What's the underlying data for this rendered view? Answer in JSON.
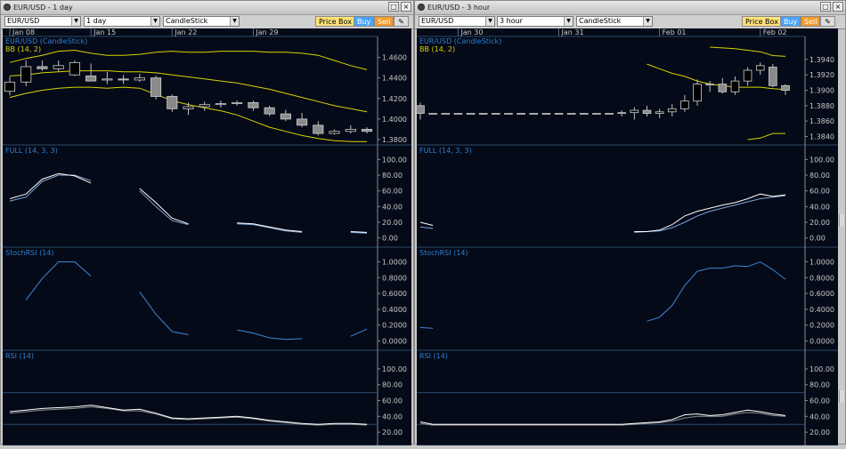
{
  "windows": [
    {
      "id": "left",
      "title": "EUR/USD - 1 day",
      "symbol": "EUR/USD",
      "interval": "1 day",
      "chart_type": "CandleStick",
      "price_box_label": "Price Box",
      "buy_label": "Buy",
      "sell_label": "Sell",
      "date_labels": [
        {
          "label": "Jan 08",
          "i": 0
        },
        {
          "label": "Jan 15",
          "i": 5
        },
        {
          "label": "Jan 22",
          "i": 10
        },
        {
          "label": "Jan 29",
          "i": 15
        }
      ],
      "panels": {
        "price": {
          "legend1": "EUR/USD (CandleStick)",
          "legend2": "BB (14, 2)",
          "ticks": [
            "1.4600",
            "1.4400",
            "1.4200",
            "1.4000",
            "1.3800"
          ],
          "min": 1.38,
          "max": 1.47
        },
        "full": {
          "legend": "FULL (14, 3, 3)",
          "ticks": [
            "100.00",
            "80.00",
            "60.00",
            "40.00",
            "20.00",
            "0.00"
          ],
          "min": -5,
          "max": 105
        },
        "stochrsi": {
          "legend": "StochRSI (14)",
          "ticks": [
            "1.0000",
            "0.8000",
            "0.6000",
            "0.4000",
            "0.2000",
            "0.0000"
          ],
          "min": -0.05,
          "max": 1.05
        },
        "rsi": {
          "legend": "RSI (14)",
          "ticks": [
            "100.00",
            "80.00",
            "60.00",
            "40.00",
            "20.00"
          ],
          "min": 10,
          "max": 110
        }
      },
      "candles": [
        {
          "o": 1.427,
          "h": 1.441,
          "l": 1.423,
          "c": 1.436
        },
        {
          "o": 1.436,
          "h": 1.457,
          "l": 1.432,
          "c": 1.451
        },
        {
          "o": 1.451,
          "h": 1.457,
          "l": 1.447,
          "c": 1.449
        },
        {
          "o": 1.449,
          "h": 1.457,
          "l": 1.446,
          "c": 1.452
        },
        {
          "o": 1.443,
          "h": 1.457,
          "l": 1.442,
          "c": 1.455
        },
        {
          "o": 1.442,
          "h": 1.454,
          "l": 1.439,
          "c": 1.437
        },
        {
          "o": 1.438,
          "h": 1.446,
          "l": 1.434,
          "c": 1.439
        },
        {
          "o": 1.439,
          "h": 1.443,
          "l": 1.434,
          "c": 1.438
        },
        {
          "o": 1.438,
          "h": 1.444,
          "l": 1.436,
          "c": 1.44
        },
        {
          "o": 1.44,
          "h": 1.442,
          "l": 1.419,
          "c": 1.422
        },
        {
          "o": 1.422,
          "h": 1.424,
          "l": 1.407,
          "c": 1.41
        },
        {
          "o": 1.41,
          "h": 1.416,
          "l": 1.404,
          "c": 1.412
        },
        {
          "o": 1.412,
          "h": 1.417,
          "l": 1.408,
          "c": 1.414
        },
        {
          "o": 1.414,
          "h": 1.418,
          "l": 1.411,
          "c": 1.415
        },
        {
          "o": 1.415,
          "h": 1.418,
          "l": 1.413,
          "c": 1.416
        },
        {
          "o": 1.416,
          "h": 1.418,
          "l": 1.408,
          "c": 1.411
        },
        {
          "o": 1.411,
          "h": 1.413,
          "l": 1.403,
          "c": 1.405
        },
        {
          "o": 1.405,
          "h": 1.409,
          "l": 1.398,
          "c": 1.4
        },
        {
          "o": 1.4,
          "h": 1.406,
          "l": 1.392,
          "c": 1.394
        },
        {
          "o": 1.394,
          "h": 1.398,
          "l": 1.384,
          "c": 1.386
        },
        {
          "o": 1.386,
          "h": 1.39,
          "l": 1.385,
          "c": 1.388
        },
        {
          "o": 1.388,
          "h": 1.394,
          "l": 1.386,
          "c": 1.39
        },
        {
          "o": 1.39,
          "h": 1.392,
          "l": 1.386,
          "c": 1.388
        }
      ],
      "bb_upper": [
        1.455,
        1.459,
        1.462,
        1.466,
        1.467,
        1.464,
        1.462,
        1.462,
        1.463,
        1.465,
        1.466,
        1.465,
        1.465,
        1.466,
        1.466,
        1.466,
        1.465,
        1.465,
        1.464,
        1.462,
        1.457,
        1.452,
        1.448
      ],
      "bb_mid": [
        1.442,
        1.443,
        1.445,
        1.446,
        1.447,
        1.447,
        1.447,
        1.446,
        1.446,
        1.445,
        1.443,
        1.441,
        1.439,
        1.437,
        1.435,
        1.432,
        1.429,
        1.425,
        1.421,
        1.417,
        1.413,
        1.41,
        1.407
      ],
      "bb_lower": [
        1.421,
        1.425,
        1.428,
        1.43,
        1.431,
        1.431,
        1.43,
        1.431,
        1.43,
        1.424,
        1.418,
        1.414,
        1.411,
        1.408,
        1.404,
        1.398,
        1.392,
        1.388,
        1.384,
        1.381,
        1.379,
        1.378,
        1.378
      ],
      "full_k": [
        50,
        56,
        75,
        82,
        79,
        70,
        null,
        null,
        63,
        45,
        25,
        18,
        null,
        null,
        19,
        18,
        14,
        10,
        8,
        null,
        null,
        8,
        7
      ],
      "full_d": [
        47,
        52,
        72,
        80,
        80,
        73,
        null,
        null,
        60,
        40,
        22,
        17,
        null,
        null,
        18,
        17,
        13,
        9,
        7,
        null,
        null,
        7,
        6
      ],
      "stochrsi": [
        null,
        0.52,
        0.79,
        1.0,
        1.0,
        0.82,
        null,
        null,
        0.62,
        0.34,
        0.12,
        0.08,
        null,
        null,
        0.14,
        0.1,
        0.04,
        0.02,
        0.03,
        null,
        null,
        0.06,
        0.15
      ],
      "rsi": [
        46,
        48,
        50,
        51,
        52,
        54,
        51,
        48,
        49,
        44,
        38,
        37,
        38,
        39,
        40,
        38,
        35,
        33,
        31,
        30,
        31,
        31,
        30
      ],
      "rsi_sig": [
        44,
        46,
        48,
        49,
        50,
        52,
        50,
        47,
        47,
        43,
        37,
        36,
        37,
        38,
        39,
        37,
        34,
        32,
        30,
        29,
        30,
        30,
        29
      ]
    },
    {
      "id": "right",
      "title": "EUR/USD - 3 hour",
      "symbol": "EUR/USD",
      "interval": "3 hour",
      "chart_type": "CandleStick",
      "price_box_label": "Price Box",
      "buy_label": "Buy",
      "sell_label": "Sell",
      "date_labels": [
        {
          "label": "Jan 30",
          "i": 3
        },
        {
          "label": "Jan 31",
          "i": 11
        },
        {
          "label": "Feb 01",
          "i": 19
        },
        {
          "label": "Feb 02",
          "i": 27
        }
      ],
      "panels": {
        "price": {
          "legend1": "EUR/USD (CandleStick)",
          "legend2": "BB (14, 2)",
          "ticks": [
            "1.3940",
            "1.3920",
            "1.3900",
            "1.3880",
            "1.3860",
            "1.3840"
          ],
          "min": 1.3836,
          "max": 1.3956
        },
        "full": {
          "legend": "FULL (14, 3, 3)",
          "ticks": [
            "100.00",
            "80.00",
            "60.00",
            "40.00",
            "20.00",
            "0.00"
          ],
          "min": -5,
          "max": 105
        },
        "stochrsi": {
          "legend": "StochRSI (14)",
          "ticks": [
            "1.0000",
            "0.8000",
            "0.6000",
            "0.4000",
            "0.2000",
            "0.0000"
          ],
          "min": -0.05,
          "max": 1.05
        },
        "rsi": {
          "legend": "RSI (14)",
          "ticks": [
            "100.00",
            "80.00",
            "60.00",
            "40.00",
            "20.00"
          ],
          "min": 10,
          "max": 110
        }
      },
      "candles": [
        {
          "o": 1.388,
          "h": 1.3884,
          "l": 1.3862,
          "c": 1.387
        },
        {
          "o": 1.387,
          "h": 1.387,
          "l": 1.387,
          "c": 1.387
        },
        {
          "o": 1.387,
          "h": 1.387,
          "l": 1.387,
          "c": 1.387
        },
        {
          "o": 1.387,
          "h": 1.387,
          "l": 1.387,
          "c": 1.387
        },
        {
          "o": 1.387,
          "h": 1.387,
          "l": 1.387,
          "c": 1.387
        },
        {
          "o": 1.387,
          "h": 1.387,
          "l": 1.387,
          "c": 1.387
        },
        {
          "o": 1.387,
          "h": 1.387,
          "l": 1.387,
          "c": 1.387
        },
        {
          "o": 1.387,
          "h": 1.387,
          "l": 1.387,
          "c": 1.387
        },
        {
          "o": 1.387,
          "h": 1.387,
          "l": 1.387,
          "c": 1.387
        },
        {
          "o": 1.387,
          "h": 1.387,
          "l": 1.387,
          "c": 1.387
        },
        {
          "o": 1.387,
          "h": 1.387,
          "l": 1.387,
          "c": 1.387
        },
        {
          "o": 1.387,
          "h": 1.387,
          "l": 1.387,
          "c": 1.387
        },
        {
          "o": 1.387,
          "h": 1.387,
          "l": 1.387,
          "c": 1.387
        },
        {
          "o": 1.387,
          "h": 1.387,
          "l": 1.387,
          "c": 1.387
        },
        {
          "o": 1.387,
          "h": 1.387,
          "l": 1.387,
          "c": 1.387
        },
        {
          "o": 1.387,
          "h": 1.387,
          "l": 1.387,
          "c": 1.387
        },
        {
          "o": 1.387,
          "h": 1.3874,
          "l": 1.3866,
          "c": 1.3871
        },
        {
          "o": 1.3871,
          "h": 1.3878,
          "l": 1.3862,
          "c": 1.3874
        },
        {
          "o": 1.3874,
          "h": 1.388,
          "l": 1.3866,
          "c": 1.387
        },
        {
          "o": 1.387,
          "h": 1.3876,
          "l": 1.3864,
          "c": 1.3872
        },
        {
          "o": 1.3872,
          "h": 1.3882,
          "l": 1.3866,
          "c": 1.3876
        },
        {
          "o": 1.3876,
          "h": 1.3894,
          "l": 1.3872,
          "c": 1.3886
        },
        {
          "o": 1.3886,
          "h": 1.3914,
          "l": 1.388,
          "c": 1.3908
        },
        {
          "o": 1.3908,
          "h": 1.3912,
          "l": 1.3898,
          "c": 1.3908
        },
        {
          "o": 1.3908,
          "h": 1.3916,
          "l": 1.3896,
          "c": 1.3898
        },
        {
          "o": 1.3898,
          "h": 1.3918,
          "l": 1.3894,
          "c": 1.3912
        },
        {
          "o": 1.3912,
          "h": 1.393,
          "l": 1.3906,
          "c": 1.3926
        },
        {
          "o": 1.3926,
          "h": 1.3936,
          "l": 1.392,
          "c": 1.3932
        },
        {
          "o": 1.393,
          "h": 1.3934,
          "l": 1.3904,
          "c": 1.3906
        },
        {
          "o": 1.3906,
          "h": 1.3908,
          "l": 1.3894,
          "c": 1.39
        }
      ],
      "bb_upper": [
        1.386,
        null,
        null,
        null,
        null,
        null,
        null,
        null,
        null,
        null,
        null,
        null,
        null,
        null,
        null,
        null,
        null,
        null,
        null,
        null,
        null,
        null,
        null,
        1.3956,
        1.3955,
        1.3954,
        1.3952,
        1.395,
        1.3945,
        1.3944
      ],
      "bb_mid": [
        null,
        null,
        null,
        null,
        null,
        null,
        null,
        null,
        null,
        null,
        null,
        null,
        null,
        null,
        null,
        null,
        null,
        null,
        1.3934,
        1.3928,
        1.3922,
        1.3918,
        1.3912,
        1.3908,
        1.3906,
        1.3904,
        1.3904,
        1.3904,
        1.3902,
        1.3901
      ],
      "bb_lower": [
        null,
        null,
        null,
        null,
        null,
        null,
        null,
        null,
        null,
        null,
        null,
        null,
        null,
        null,
        null,
        null,
        null,
        null,
        null,
        null,
        null,
        null,
        null,
        null,
        null,
        null,
        1.3836,
        1.3838,
        1.3844,
        1.3844
      ],
      "full_k": [
        20,
        16,
        null,
        null,
        null,
        null,
        null,
        null,
        null,
        null,
        null,
        null,
        null,
        null,
        null,
        null,
        null,
        8,
        8,
        10,
        17,
        28,
        34,
        38,
        42,
        45,
        50,
        56,
        53,
        55
      ],
      "full_d": [
        14,
        12,
        null,
        null,
        null,
        null,
        null,
        null,
        null,
        null,
        null,
        null,
        null,
        null,
        null,
        null,
        null,
        7,
        8,
        9,
        13,
        20,
        28,
        34,
        38,
        42,
        46,
        50,
        52,
        54
      ],
      "stochrsi": [
        0.17,
        0.16,
        null,
        null,
        null,
        null,
        null,
        null,
        null,
        null,
        null,
        null,
        null,
        null,
        null,
        null,
        null,
        null,
        0.25,
        0.3,
        0.45,
        0.7,
        0.88,
        0.92,
        0.92,
        0.95,
        0.94,
        1.0,
        0.9,
        0.78
      ],
      "rsi": [
        33,
        30,
        30,
        30,
        30,
        30,
        30,
        30,
        30,
        30,
        30,
        30,
        30,
        30,
        30,
        30,
        30,
        31,
        32,
        33,
        36,
        42,
        43,
        41,
        42,
        45,
        48,
        46,
        43,
        41
      ],
      "rsi_sig": [
        31,
        29,
        29,
        29,
        29,
        29,
        29,
        29,
        29,
        29,
        29,
        29,
        29,
        29,
        29,
        29,
        29,
        30,
        31,
        32,
        34,
        38,
        40,
        40,
        40,
        43,
        45,
        44,
        41,
        40
      ]
    }
  ],
  "colors": {
    "bg": "#050a18",
    "grid": "#2a4a6a",
    "axis_text": "#c8c8c8",
    "legend_text": "#2f7fd1",
    "bb": "#d8d400",
    "stoch_k": "#ffffff",
    "stoch_d": "#7da6d8",
    "stochrsi": "#3f86d8",
    "rsi": "#ffffff",
    "rsi_sig": "#8f8f8f",
    "bull": "#000000",
    "bear": "#8a8a8a",
    "wick": "#bfbfbf"
  }
}
